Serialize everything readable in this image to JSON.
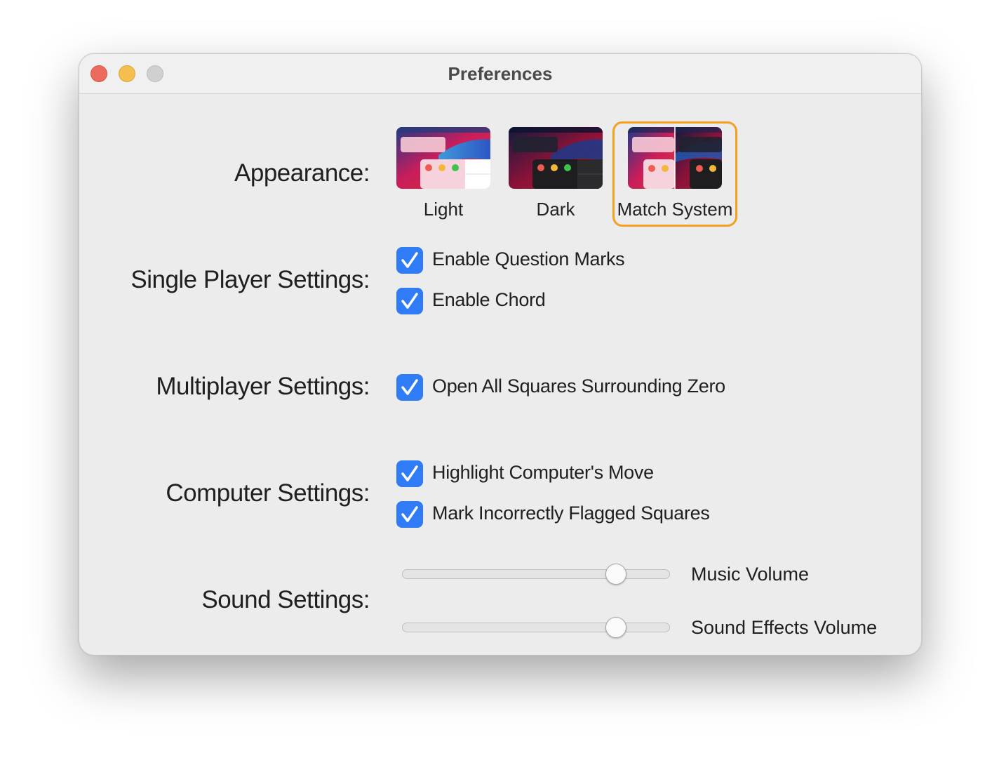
{
  "window": {
    "title": "Preferences"
  },
  "traffic_lights": {
    "close_color": "#ed6a5e",
    "minimize_color": "#f5bf4f",
    "zoom_color": "#d1d0d1"
  },
  "appearance": {
    "label": "Appearance:",
    "options": [
      {
        "label": "Light",
        "selected": false
      },
      {
        "label": "Dark",
        "selected": false
      },
      {
        "label": "Match System",
        "selected": true
      }
    ],
    "selection_color": "#f6a023"
  },
  "single_player": {
    "label": "Single Player Settings:",
    "options": [
      {
        "label": "Enable Question Marks",
        "checked": true
      },
      {
        "label": "Enable Chord",
        "checked": true
      }
    ]
  },
  "multiplayer": {
    "label": "Multiplayer Settings:",
    "options": [
      {
        "label": "Open All Squares Surrounding Zero",
        "checked": true
      }
    ]
  },
  "computer": {
    "label": "Computer Settings:",
    "options": [
      {
        "label": "Highlight Computer's Move",
        "checked": true
      },
      {
        "label": "Mark Incorrectly Flagged Squares",
        "checked": true
      }
    ]
  },
  "sound": {
    "label": "Sound Settings:",
    "sliders": [
      {
        "label": "Music Volume",
        "level": 0.8
      },
      {
        "label": "Sound Effects Volume",
        "level": 0.8
      }
    ]
  },
  "accent_color": "#2f7cf6"
}
